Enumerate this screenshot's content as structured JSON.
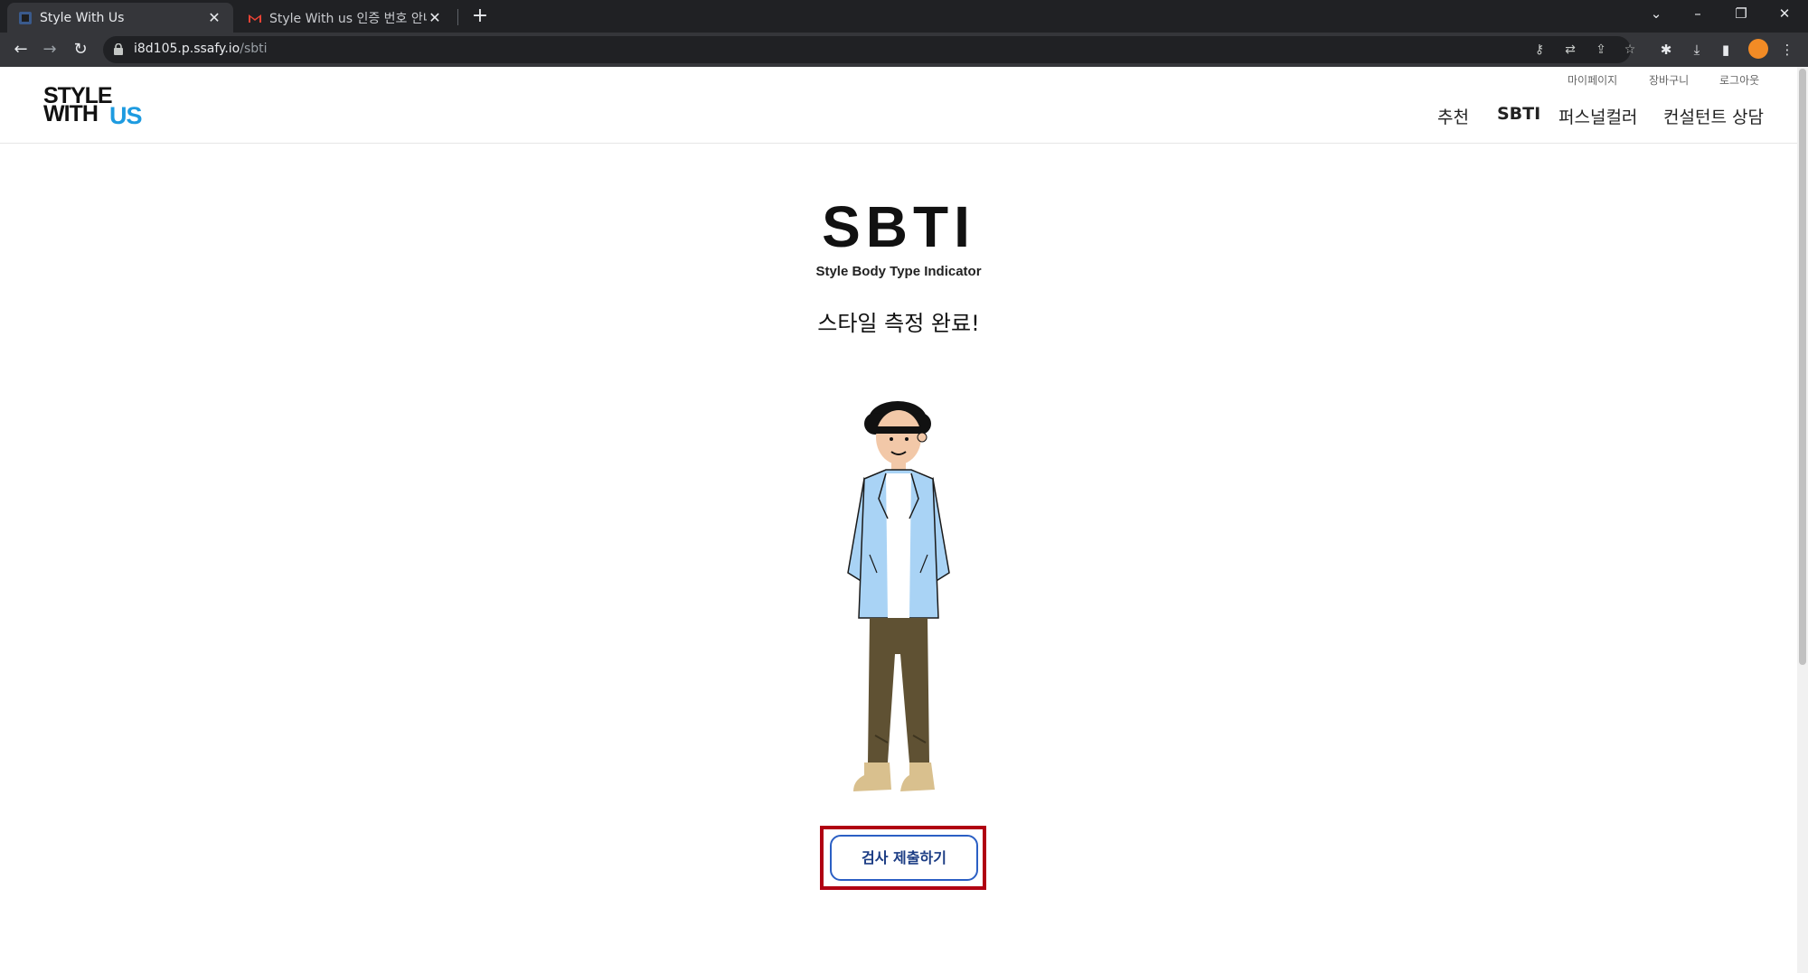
{
  "browser": {
    "tabs": [
      {
        "title": "Style With Us",
        "active": true,
        "favicon": "site-favicon"
      },
      {
        "title": "Style With us 인증 번호 안내 - c",
        "active": false,
        "favicon": "gmail-icon"
      }
    ],
    "new_tab_symbol": "+",
    "url_host": "i8d105.p.ssafy.io",
    "url_path": "/sbti"
  },
  "header": {
    "logo": {
      "line1": "STYLE",
      "line2": "WITH",
      "accent": "US",
      "accent_color": "#1e9be0"
    },
    "util_links": [
      "마이페이지",
      "장바구니",
      "로그아웃"
    ],
    "nav": [
      "추천",
      "SBTI",
      "퍼스널컬러",
      "컨설턴트 상담"
    ],
    "current_nav": "SBTI"
  },
  "main": {
    "title": "SBTI",
    "subtitle": "Style Body Type Indicator",
    "status": "스타일 측정 완료!",
    "illustration": "person-illustration",
    "submit_label": "검사 제출하기",
    "highlight_color": "#b00012",
    "button_color": "#2b5fc4"
  }
}
